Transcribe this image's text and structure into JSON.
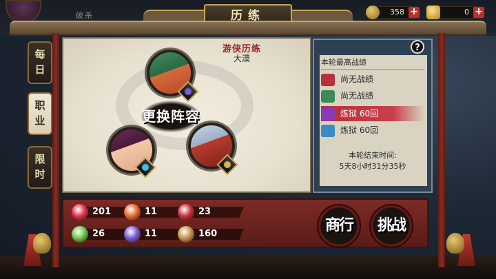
{
  "header": {
    "title": "历练",
    "skill_label": "破杀",
    "resources": [
      {
        "icon": "coin-icon",
        "value": "358"
      },
      {
        "icon": "gold-ingot-icon",
        "value": "0"
      }
    ],
    "plus_label": "+"
  },
  "side_tabs": [
    {
      "label": [
        "每",
        "日"
      ],
      "active": false
    },
    {
      "label": [
        "职",
        "业"
      ],
      "active": true
    },
    {
      "label": [
        "限",
        "时"
      ],
      "active": false
    }
  ],
  "stage": {
    "title": "游侠历练",
    "subtitle": "大漠",
    "swap_button": "更换阵容"
  },
  "record": {
    "help": "?",
    "heading": "本轮最高战绩",
    "rows": [
      {
        "tag_color": "#b7303a",
        "text": "尚无战绩"
      },
      {
        "tag_color": "#3a8a5a",
        "text": "尚无战绩"
      },
      {
        "tag_color": "#8a3ab8",
        "text": "炼狱 60回"
      },
      {
        "tag_color": "#3a8ac8",
        "text": "炼狱 60回"
      }
    ],
    "end_label": "本轮结束时间:",
    "end_time": "5天8小时31分35秒"
  },
  "stats": [
    {
      "icon": "heart-icon",
      "color": "#e0344a",
      "value": "201"
    },
    {
      "icon": "fire-icon",
      "color": "#e86a2a",
      "value": "11"
    },
    {
      "icon": "meat-icon",
      "color": "#c8303a",
      "value": "23"
    },
    {
      "icon": "sword-icon",
      "color": "#6ac84a",
      "value": "26"
    },
    {
      "icon": "armor-icon",
      "color": "#7a5ad8",
      "value": "11"
    },
    {
      "icon": "coins-icon",
      "color": "#c8944a",
      "value": "160"
    }
  ],
  "actions": {
    "shop": "商行",
    "challenge": "挑战"
  }
}
